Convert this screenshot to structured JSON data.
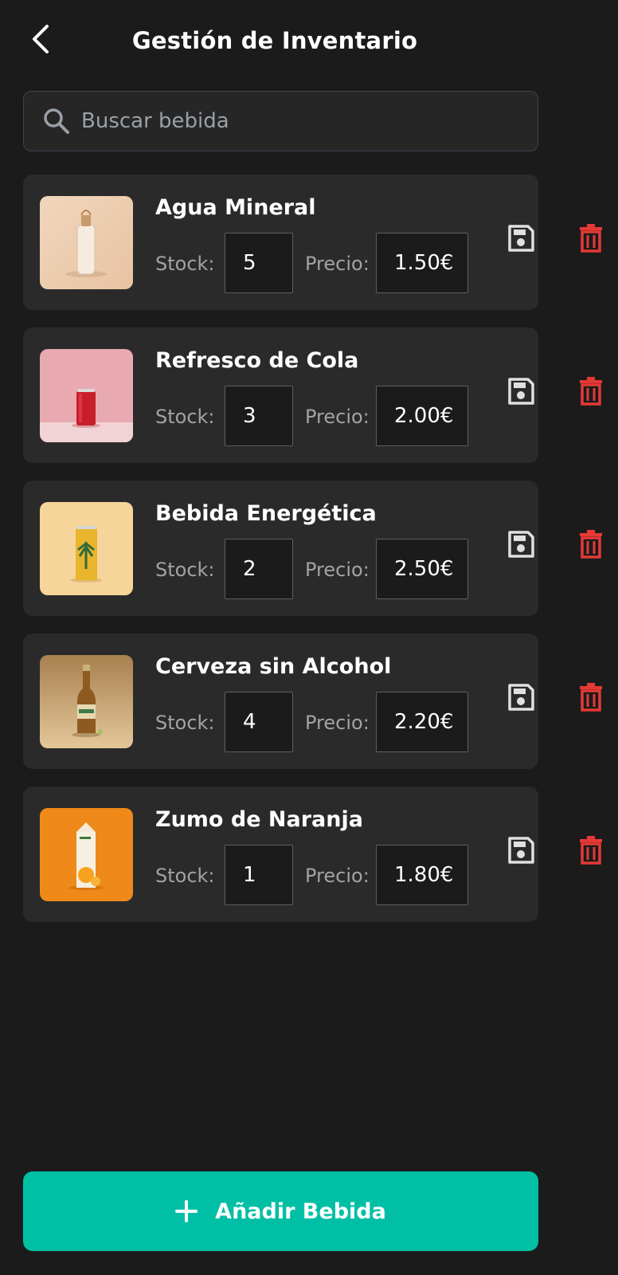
{
  "header": {
    "title": "Gestión de Inventario"
  },
  "search": {
    "placeholder": "Buscar bebida",
    "value": ""
  },
  "labels": {
    "stock": "Stock:",
    "price": "Precio:"
  },
  "items": [
    {
      "name": "Agua Mineral",
      "stock": "5",
      "price": "1.50€",
      "image": "water-bottle"
    },
    {
      "name": "Refresco de Cola",
      "stock": "3",
      "price": "2.00€",
      "image": "red-can"
    },
    {
      "name": "Bebida Energética",
      "stock": "2",
      "price": "2.50€",
      "image": "yellow-can"
    },
    {
      "name": "Cerveza sin Alcohol",
      "stock": "4",
      "price": "2.20€",
      "image": "beer-bottle"
    },
    {
      "name": "Zumo de Naranja",
      "stock": "1",
      "price": "1.80€",
      "image": "orange-juice-carton"
    }
  ],
  "add_button": {
    "label": "Añadir Bebida"
  },
  "colors": {
    "background": "#1b1b1b",
    "card": "#2a2a2a",
    "accent": "#00bfa5",
    "delete": "#e53935",
    "save": "#e0e0e0"
  }
}
